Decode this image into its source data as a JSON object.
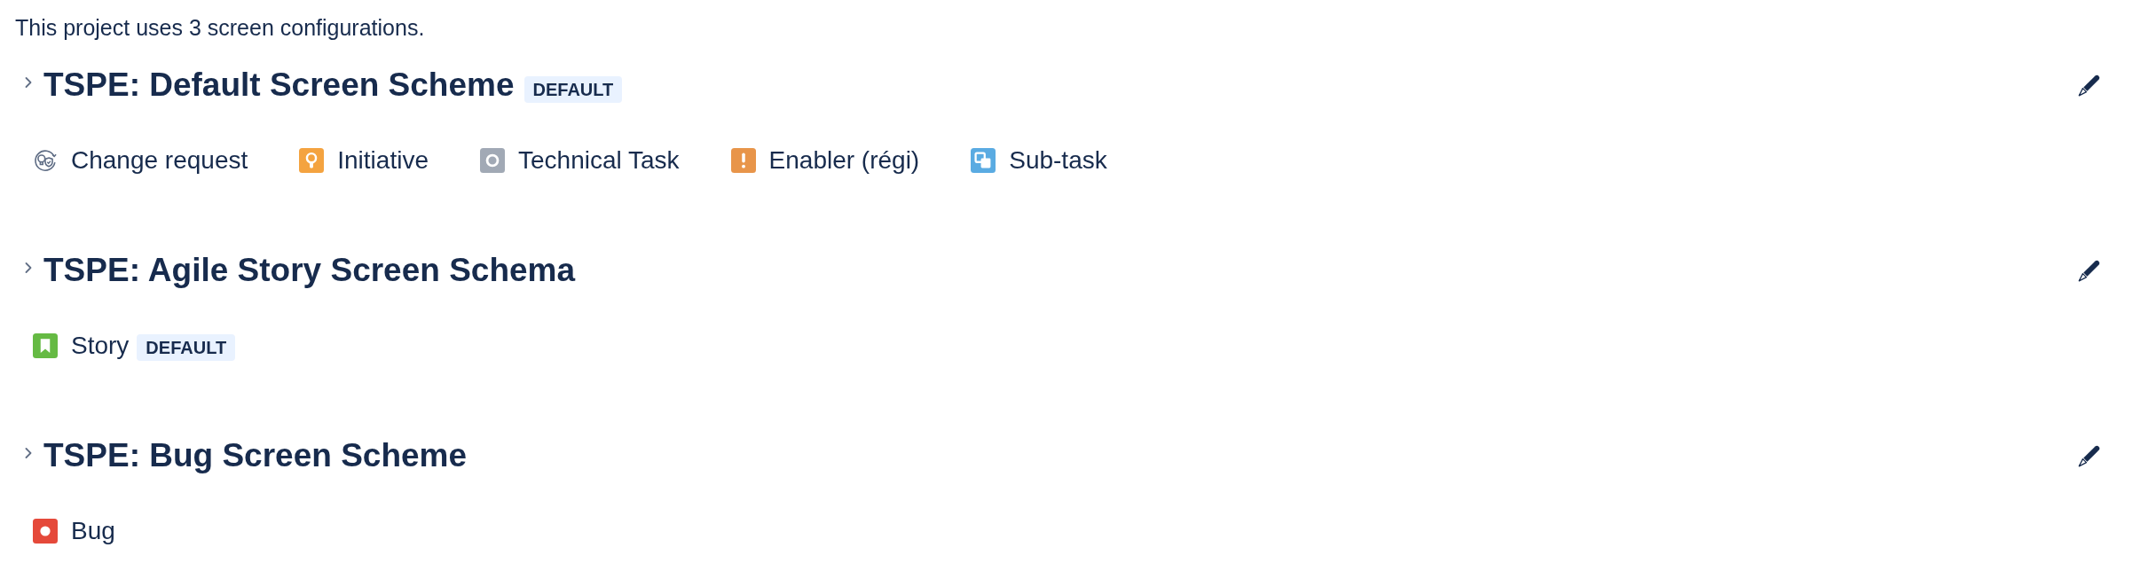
{
  "intro": "This project uses 3 screen configurations.",
  "schemes": [
    {
      "title": "TSPE: Default Screen Scheme",
      "badge": "DEFAULT",
      "expanded": false,
      "issue_types": [
        {
          "kind": "change_request",
          "name": "Change request"
        },
        {
          "kind": "initiative",
          "name": "Initiative"
        },
        {
          "kind": "technical_task",
          "name": "Technical Task"
        },
        {
          "kind": "enabler",
          "name": "Enabler (régi)"
        },
        {
          "kind": "subtask",
          "name": "Sub-task"
        }
      ]
    },
    {
      "title": "TSPE: Agile Story Screen Schema",
      "expanded": false,
      "issue_types": [
        {
          "kind": "story",
          "name": "Story",
          "badge": "DEFAULT"
        }
      ]
    },
    {
      "title": "TSPE: Bug Screen Scheme",
      "expanded": false,
      "issue_types": [
        {
          "kind": "bug",
          "name": "Bug"
        }
      ]
    }
  ]
}
